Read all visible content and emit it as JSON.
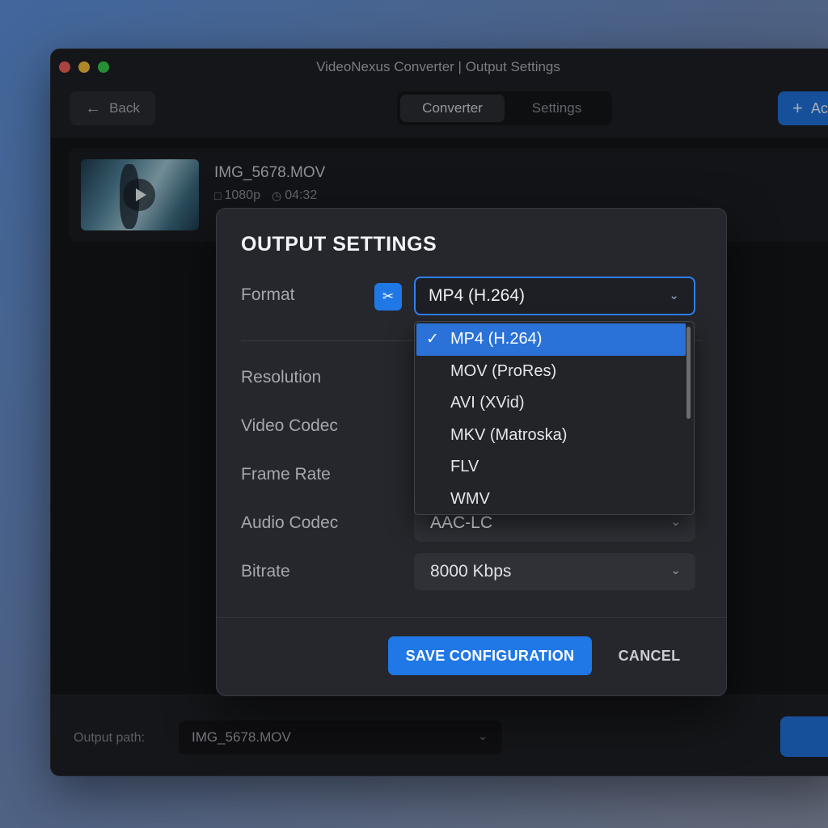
{
  "window": {
    "title": "VideoNexus Converter | Output Settings"
  },
  "toolbar": {
    "back_label": "Back",
    "tabs": [
      {
        "label": "Converter",
        "active": true
      },
      {
        "label": "Settings",
        "active": false
      }
    ],
    "add_label": "Ac"
  },
  "file": {
    "name": "IMG_5678.MOV",
    "resolution": "1080p",
    "duration": "04:32"
  },
  "bottom": {
    "output_label": "Output path:",
    "output_value": "IMG_5678.MOV"
  },
  "modal": {
    "title": "OUTPUT SETTINGS",
    "format_label": "Format",
    "format_value": "MP4 (H.264)",
    "rows": [
      {
        "label": "Resolution",
        "value": ""
      },
      {
        "label": "Video Codec",
        "value": ""
      },
      {
        "label": "Frame Rate",
        "value": ""
      },
      {
        "label": "Audio Codec",
        "value": "AAC-LC"
      },
      {
        "label": "Bitrate",
        "value": "8000 Kbps"
      }
    ],
    "save_label": "SAVE CONFIGURATION",
    "cancel_label": "CANCEL"
  },
  "dropdown": {
    "options": [
      "MP4 (H.264)",
      "MOV (ProRes)",
      "AVI (XVid)",
      "MKV (Matroska)",
      "FLV",
      "WMV"
    ],
    "selected_index": 0
  },
  "colors": {
    "accent": "#1f78e6",
    "background": "#1c1d21",
    "modal": "#26272c"
  }
}
